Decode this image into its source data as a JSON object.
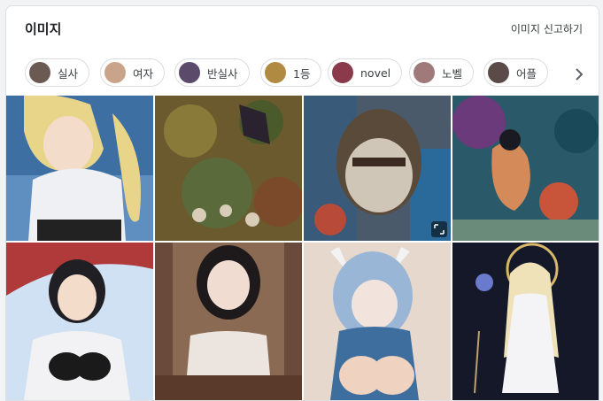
{
  "header": {
    "title": "이미지",
    "report_link": "이미지 신고하기"
  },
  "chips": [
    {
      "label": "실사",
      "thumb_color": "#6b5a52"
    },
    {
      "label": "여자",
      "thumb_color": "#c9a48a"
    },
    {
      "label": "반실사",
      "thumb_color": "#5b4a6a"
    },
    {
      "label": "1등",
      "thumb_color": "#b08a40"
    },
    {
      "label": "novel",
      "thumb_color": "#8a3a4a"
    },
    {
      "label": "노벨",
      "thumb_color": "#a07a7a"
    },
    {
      "label": "어플",
      "thumb_color": "#5a4a48"
    }
  ],
  "icons": {
    "next": "chevron-right-icon",
    "expand": "expand-icon"
  },
  "colors": {
    "chip_border": "#dadce0",
    "text": "#202124",
    "card_bg": "#ffffff"
  }
}
